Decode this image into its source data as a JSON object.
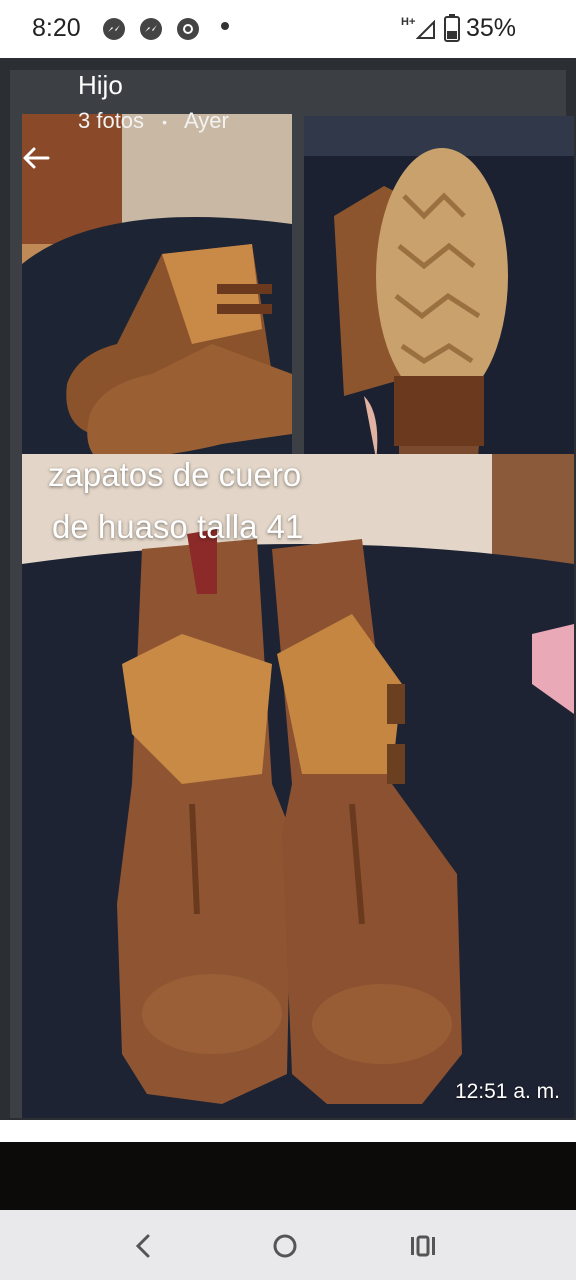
{
  "status_bar": {
    "time": "8:20",
    "icons": [
      "messenger-icon",
      "messenger-icon",
      "chrome-icon"
    ],
    "network_label": "H+",
    "battery": "35%"
  },
  "header": {
    "title": "Hijo",
    "photo_count": "3 fotos",
    "separator": "•",
    "date": "Ayer"
  },
  "caption": {
    "line1": "zapatos de cuero",
    "line2": "de huaso talla 41"
  },
  "timestamp": "12:51 a. m.",
  "nav": {
    "icons": [
      "back-nav-icon",
      "home-nav-icon",
      "recents-nav-icon"
    ]
  }
}
